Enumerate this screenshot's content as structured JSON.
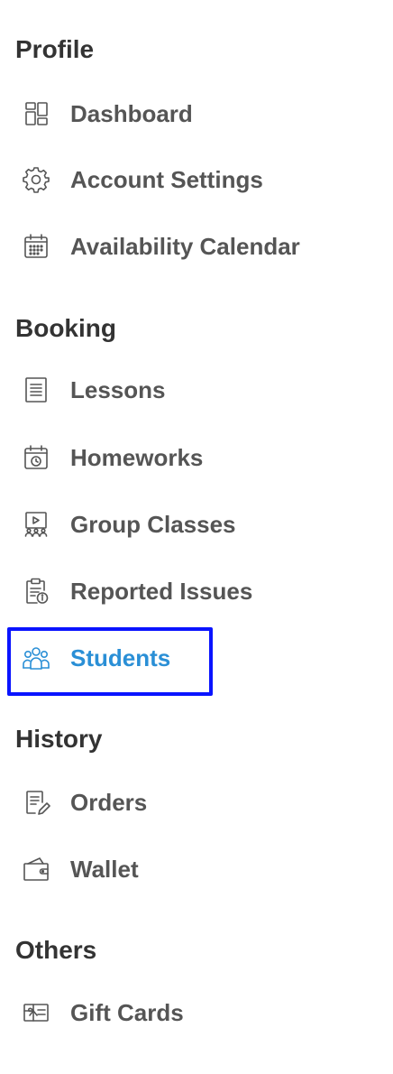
{
  "sections": {
    "profile": {
      "title": "Profile",
      "items": [
        {
          "label": "Dashboard",
          "icon": "dashboard-icon"
        },
        {
          "label": "Account Settings",
          "icon": "gear-icon"
        },
        {
          "label": "Availability Calendar",
          "icon": "calendar-icon"
        }
      ]
    },
    "booking": {
      "title": "Booking",
      "items": [
        {
          "label": "Lessons",
          "icon": "document-list-icon"
        },
        {
          "label": "Homeworks",
          "icon": "calendar-clock-icon"
        },
        {
          "label": "Group Classes",
          "icon": "group-class-icon"
        },
        {
          "label": "Reported Issues",
          "icon": "clipboard-info-icon"
        },
        {
          "label": "Students",
          "icon": "students-icon",
          "active": true
        }
      ]
    },
    "history": {
      "title": "History",
      "items": [
        {
          "label": "Orders",
          "icon": "orders-icon"
        },
        {
          "label": "Wallet",
          "icon": "wallet-icon"
        }
      ]
    },
    "others": {
      "title": "Others",
      "items": [
        {
          "label": "Gift Cards",
          "icon": "gift-card-icon"
        }
      ]
    }
  },
  "colors": {
    "text": "#555555",
    "heading": "#333333",
    "active": "#2a8fd6",
    "highlight": "#0a14ff"
  }
}
